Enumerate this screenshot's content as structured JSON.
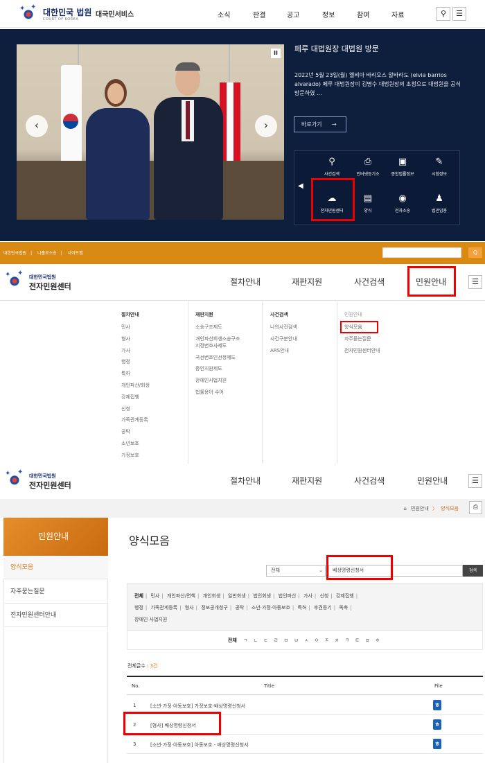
{
  "court_site": {
    "brand_name": "대한민국 법원",
    "brand_sub": "COURT OF KOREA",
    "service_name": "대국민서비스",
    "nav": [
      "소식",
      "판결",
      "공고",
      "정보",
      "참여",
      "자료"
    ],
    "search_icon": "search-icon",
    "menu_icon": "menu-icon",
    "hero": {
      "title": "페루 대법원장 대법원 방문",
      "description": "2022년 5월 23일(월) 엘비아 바리오스 알바라도 (elvia barrios alvarado) 페루 대법원장이 김명수 대법원장의 초청으로 대법원을 공식 방문하였 ...",
      "goto_label": "바로가기",
      "goto_arrow": "→"
    },
    "quick_menu": [
      {
        "label": "사건검색",
        "icon": "magnifier-doc-icon"
      },
      {
        "label": "인터넷등기소",
        "icon": "printer-icon"
      },
      {
        "label": "종합법률정보",
        "icon": "law-info-icon"
      },
      {
        "label": "시험정보",
        "icon": "pen-icon"
      },
      {
        "label": "전자민원센터",
        "icon": "ecenter-icon"
      },
      {
        "label": "양식",
        "icon": "form-icon"
      },
      {
        "label": "전자소송",
        "icon": "mouse-icon"
      },
      {
        "label": "법관임용",
        "icon": "judge-icon"
      }
    ]
  },
  "ecenter": {
    "top_links": [
      "대한민국법원",
      "나홀로소송",
      "사이트맵"
    ],
    "search_button": "Q",
    "logo_small": "대한민국법원",
    "logo_big": "전자민원센터",
    "nav": [
      "절차안내",
      "재판지원",
      "사건검색",
      "민원안내"
    ],
    "mega_menu": [
      {
        "heading": "절차안내",
        "items": [
          "민사",
          "형사",
          "가사",
          "행정",
          "특허",
          "개인파산/회생",
          "강제집행",
          "신청",
          "가족관계등록",
          "공탁",
          "소년보호",
          "가정보호"
        ]
      },
      {
        "heading": "재판지원",
        "items": [
          "소송구조제도",
          "개인파산회생소송구조",
          "지정변호사제도",
          "국선변호인선정제도",
          "증인지원제도",
          "장애인사법지원",
          "법률용어 수어"
        ]
      },
      {
        "heading": "사건검색",
        "items": [
          "나의사건검색",
          "사건구분안내",
          "ARS안내"
        ]
      },
      {
        "heading": "민원안내",
        "items": [
          "양식모음",
          "자주묻는질문",
          "전자민원센터안내"
        ]
      }
    ]
  },
  "forms_page": {
    "breadcrumb_home": "⌂",
    "breadcrumb_parent": "민원안내",
    "breadcrumb_sep": "〉",
    "breadcrumb_current": "양식모음",
    "print_icon": "printer-icon",
    "sidebar_title": "민원안내",
    "sidebar_items": [
      "양식모음",
      "자주묻는질문",
      "전자민원센터안내"
    ],
    "page_title": "양식모음",
    "select_value": "전체",
    "search_value": "배상명령신청서",
    "search_button": "검색",
    "categories": [
      "전체",
      "민사",
      "개인파산/면책",
      "개인회생",
      "일반회생",
      "법인회생",
      "법인파산",
      "가사",
      "신청",
      "강제집행",
      "행정",
      "가족관계등록",
      "형사",
      "정보공개청구",
      "공탁",
      "소년·가정·아동보호",
      "특허",
      "후견등기",
      "독촉",
      "장애인 사법지원"
    ],
    "alpha_all": "전체",
    "alpha_letters": "ㄱ ㄴ ㄷ ㄹ ㅁ ㅂ ㅅ ㅇ ㅈ ㅊ ㅋ ㅌ ㅍ ㅎ",
    "count_label": "전체글수 : ",
    "count_value": "3건",
    "table_headers": {
      "no": "No.",
      "title": "Title",
      "file": "File"
    },
    "rows": [
      {
        "no": "1",
        "title": "[소년·가정·아동보호] 가정보호-배상명령신청서"
      },
      {
        "no": "2",
        "title": "[형사] 배상명령신청서"
      },
      {
        "no": "3",
        "title": "[소년·가정·아동보호] 아동보호 - 배상명령신청서"
      }
    ]
  },
  "colors": {
    "navy": "#0d1f3d",
    "orange": "#d98a12",
    "highlight": "#e00000",
    "accent": "#e2791a"
  }
}
